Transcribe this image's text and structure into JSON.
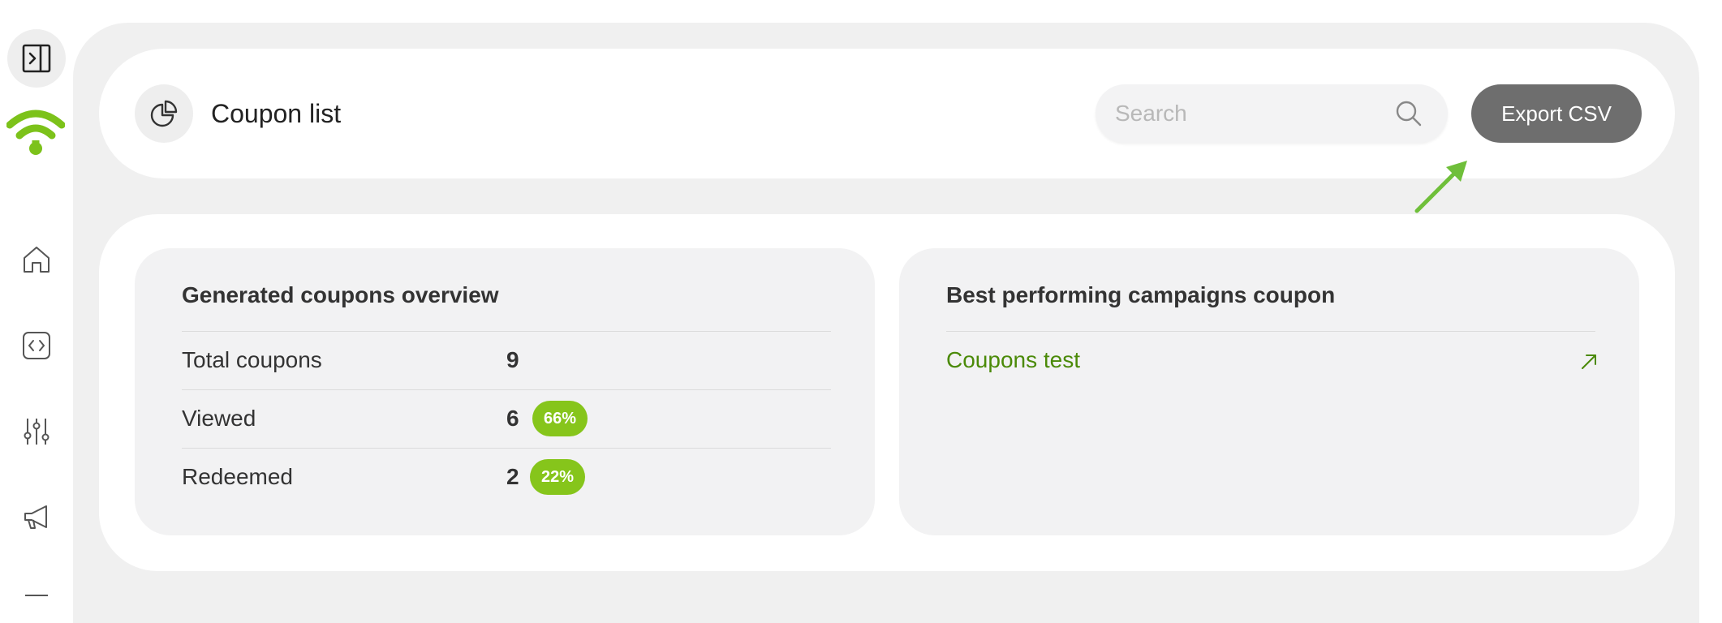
{
  "header": {
    "title": "Coupon list",
    "search_placeholder": "Search",
    "export_label": "Export CSV"
  },
  "overview": {
    "title": "Generated coupons overview",
    "rows": [
      {
        "label": "Total coupons",
        "value": "9",
        "badge": ""
      },
      {
        "label": "Viewed",
        "value": "6",
        "badge": "66%"
      },
      {
        "label": "Redeemed",
        "value": "2",
        "badge": "22%"
      }
    ]
  },
  "best": {
    "title": "Best performing campaigns coupon",
    "items": [
      {
        "label": "Coupons test"
      }
    ]
  },
  "colors": {
    "brand_green": "#7cc21a",
    "badge_green": "#86c51b",
    "link_green": "#4b8a08",
    "export_button": "#6e6e6e",
    "frame_gray": "#f0f0f0"
  },
  "icons": {
    "sidebar": [
      "sidebar-toggle-icon",
      "wifi-logo-icon",
      "home-icon",
      "code-icon",
      "sliders-icon",
      "megaphone-icon"
    ],
    "header": [
      "pie-chart-icon",
      "search-icon"
    ],
    "links": [
      "arrow-up-right-icon"
    ]
  }
}
